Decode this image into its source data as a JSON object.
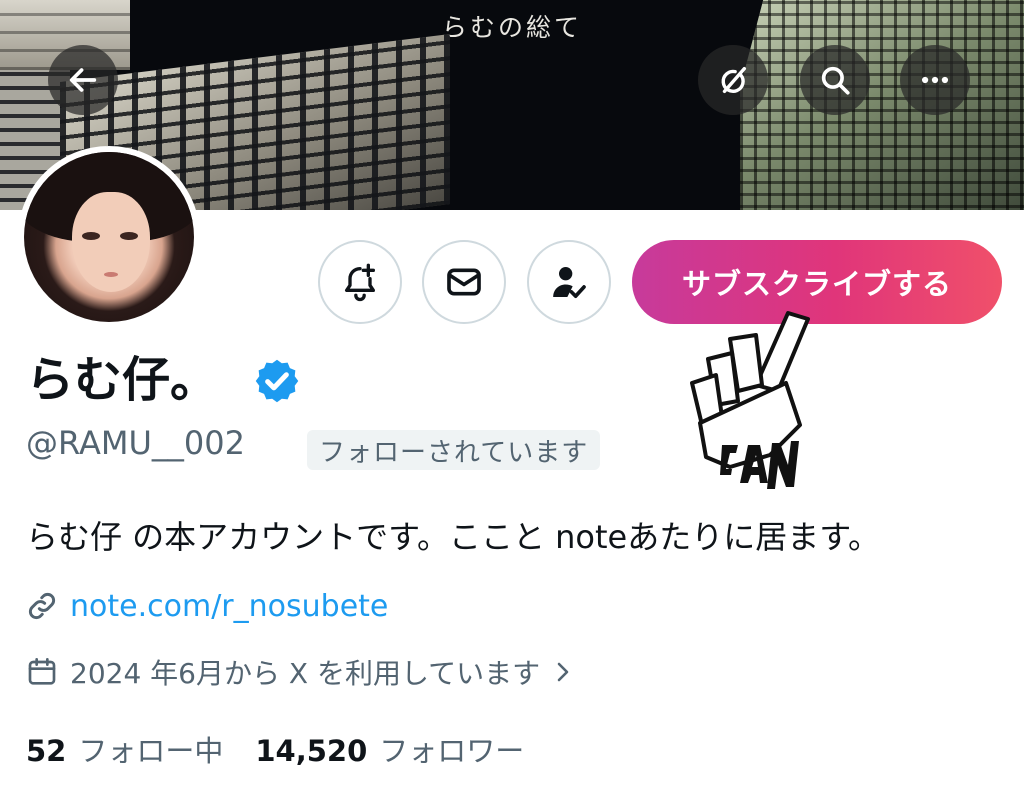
{
  "banner": {
    "title": "らむの総て",
    "back_icon": "arrow-left-icon",
    "grok_icon": "grok-icon",
    "search_icon": "search-icon",
    "more_icon": "more-horizontal-icon"
  },
  "actions": {
    "notify_icon": "bell-plus-icon",
    "message_icon": "envelope-icon",
    "following_icon": "person-check-icon",
    "subscribe_label": "サブスクライブする"
  },
  "sticker": {
    "text": "FAN"
  },
  "profile": {
    "display_name": "らむ仔。",
    "handle": "@RAMU__002",
    "follows_you": "フォローされています",
    "bio": "らむ仔 の本アカウントです。ここと noteあたりに居ます。",
    "link": "note.com/r_nosubete",
    "joined": "2024 年6月から X を利用しています"
  },
  "stats": {
    "following_count": "52",
    "following_label": "フォロー中",
    "followers_count": "14,520",
    "followers_label": "フォロワー"
  },
  "colors": {
    "link": "#1d9bf0",
    "muted": "#536471",
    "subscribe_gradient_start": "#c73a9b",
    "subscribe_gradient_end": "#f0506a",
    "verified": "#1d9bf0"
  }
}
